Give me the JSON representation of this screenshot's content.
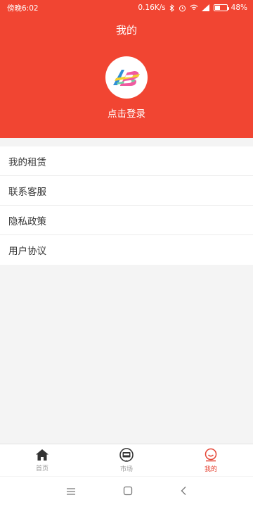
{
  "status_bar": {
    "time": "傍晚6:02",
    "net_speed": "0.16K/s",
    "battery": "48%",
    "battery_level": 0.48
  },
  "header": {
    "title": "我的",
    "login_label": "点击登录",
    "bg_color": "#f14532"
  },
  "menu": {
    "items": [
      {
        "label": "我的租赁"
      },
      {
        "label": "联系客服"
      },
      {
        "label": "隐私政策"
      },
      {
        "label": "用户协议"
      }
    ]
  },
  "tabbar": {
    "tabs": [
      {
        "label": "首页",
        "icon": "home-icon",
        "active": false
      },
      {
        "label": "市场",
        "icon": "market-icon",
        "active": false
      },
      {
        "label": "我的",
        "icon": "profile-icon",
        "active": true
      }
    ],
    "active_color": "#e54535"
  },
  "navbar": {
    "icons": [
      "menu-icon",
      "home-square-icon",
      "back-icon"
    ]
  }
}
